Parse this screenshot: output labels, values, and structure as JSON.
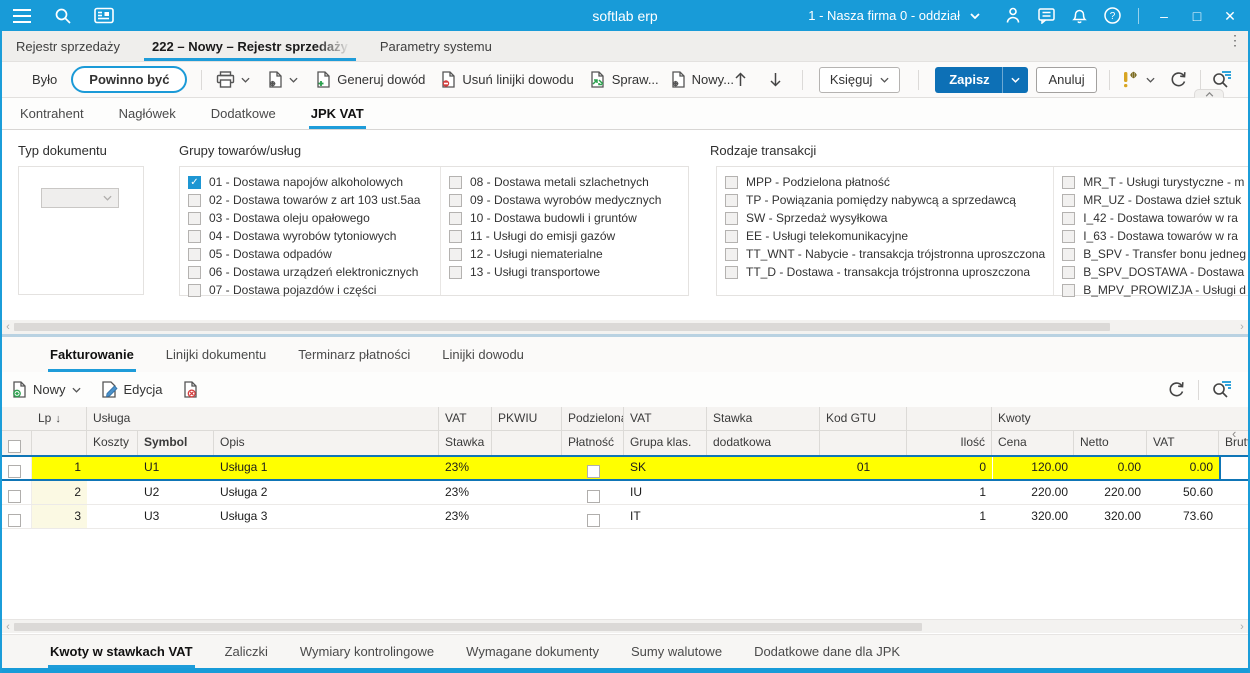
{
  "window": {
    "title": "softlab erp",
    "company": "1 - Nasza firma 0 - oddział"
  },
  "main_tabs": [
    {
      "label": "Rejestr sprzedaży",
      "active": false
    },
    {
      "label": "222 – Nowy – Rejestr sprzedaży",
      "active": true
    },
    {
      "label": "Parametry systemu",
      "active": false
    }
  ],
  "toolbar": {
    "bylo": "Było",
    "powinno_byc": "Powinno być",
    "generuj_dowod": "Generuj dowód",
    "usun_linijki": "Usuń linijki dowodu",
    "spraw": "Spraw...",
    "nowy": "Nowy...",
    "ksieguj": "Księguj",
    "zapisz": "Zapisz",
    "anuluj": "Anuluj"
  },
  "subtabs": [
    {
      "label": "Kontrahent",
      "active": false
    },
    {
      "label": "Nagłówek",
      "active": false
    },
    {
      "label": "Dodatkowe",
      "active": false
    },
    {
      "label": "JPK VAT",
      "active": true
    }
  ],
  "form": {
    "typ_dokumentu_label": "Typ dokumentu",
    "grupy_label": "Grupy towarów/usług",
    "grupy_col1": [
      {
        "label": "01 - Dostawa napojów alkoholowych",
        "checked": true
      },
      {
        "label": "02 - Dostawa towarów z art 103 ust.5aa",
        "checked": false
      },
      {
        "label": "03 - Dostawa oleju opałowego",
        "checked": false
      },
      {
        "label": "04 - Dostawa wyrobów tytoniowych",
        "checked": false
      },
      {
        "label": "05 - Dostawa odpadów",
        "checked": false
      },
      {
        "label": "06 - Dostawa urządzeń elektronicznych",
        "checked": false
      },
      {
        "label": "07 - Dostawa pojazdów i części",
        "checked": false
      }
    ],
    "grupy_col2": [
      {
        "label": "08 - Dostawa metali szlachetnych",
        "checked": false
      },
      {
        "label": "09 - Dostawa wyrobów medycznych",
        "checked": false
      },
      {
        "label": "10 - Dostawa budowli i gruntów",
        "checked": false
      },
      {
        "label": "11 - Usługi do emisji gazów",
        "checked": false
      },
      {
        "label": "12 - Usługi niematerialne",
        "checked": false
      },
      {
        "label": "13 - Usługi transportowe",
        "checked": false
      }
    ],
    "rodzaje_label": "Rodzaje transakcji",
    "rodzaje_col1": [
      {
        "label": "MPP - Podzielona płatność",
        "checked": false
      },
      {
        "label": "TP - Powiązania pomiędzy nabywcą a sprzedawcą",
        "checked": false
      },
      {
        "label": "SW - Sprzedaż wysyłkowa",
        "checked": false
      },
      {
        "label": "EE - Usługi telekomunikacyjne",
        "checked": false
      },
      {
        "label": "TT_WNT - Nabycie - transakcja trójstronna uproszczona",
        "checked": false
      },
      {
        "label": "TT_D - Dostawa - transakcja trójstronna uproszczona",
        "checked": false
      }
    ],
    "rodzaje_col2": [
      {
        "label": "MR_T - Usługi turystyczne - m",
        "checked": false
      },
      {
        "label": "MR_UZ - Dostawa dzieł sztuk",
        "checked": false
      },
      {
        "label": "I_42 - Dostawa towarów w ra",
        "checked": false
      },
      {
        "label": "I_63 - Dostawa towarów w ra",
        "checked": false
      },
      {
        "label": "B_SPV - Transfer bonu jedneg",
        "checked": false
      },
      {
        "label": "B_SPV_DOSTAWA - Dostawa",
        "checked": false
      },
      {
        "label": "B_MPV_PROWIZJA - Usługi d",
        "checked": false
      }
    ]
  },
  "section_tabs": [
    {
      "label": "Fakturowanie",
      "active": true
    },
    {
      "label": "Linijki dokumentu",
      "active": false
    },
    {
      "label": "Terminarz płatności",
      "active": false
    },
    {
      "label": "Linijki dowodu",
      "active": false
    }
  ],
  "grid_toolbar": {
    "nowy": "Nowy",
    "edycja": "Edycja"
  },
  "grid": {
    "headers": {
      "lp": "Lp",
      "usluga": "Usługa",
      "koszty": "Koszty",
      "symbol": "Symbol",
      "opis": "Opis",
      "vat": "VAT",
      "stawka": "Stawka",
      "pkwiu": "PKWIU",
      "podzielona": "Podzielona",
      "platnosc": "Płatność",
      "vat_grupa": "VAT",
      "grupa_klas": "Grupa klas.",
      "stawka_dod": "Stawka",
      "dodatkowa": "dodatkowa",
      "kod_gtu": "Kod GTU",
      "ilosc": "Ilość",
      "kwoty": "Kwoty",
      "cena": "Cena",
      "netto": "Netto",
      "vat_kwota": "VAT",
      "brutto": "Brutto"
    },
    "rows": [
      {
        "lp": "1",
        "koszty": "",
        "symbol": "U1",
        "opis": "Usługa 1",
        "stawka": "23%",
        "pkwiu": "",
        "podzielona": false,
        "grupa_klas": "SK",
        "stawka_dod": "",
        "kod_gtu": "01",
        "ilosc": "0",
        "cena": "120.00",
        "netto": "0.00",
        "vat": "0.00",
        "brutto": "",
        "selected": true
      },
      {
        "lp": "2",
        "koszty": "",
        "symbol": "U2",
        "opis": "Usługa 2",
        "stawka": "23%",
        "pkwiu": "",
        "podzielona": false,
        "grupa_klas": "IU",
        "stawka_dod": "",
        "kod_gtu": "",
        "ilosc": "1",
        "cena": "220.00",
        "netto": "220.00",
        "vat": "50.60",
        "brutto": "",
        "selected": false
      },
      {
        "lp": "3",
        "koszty": "",
        "symbol": "U3",
        "opis": "Usługa 3",
        "stawka": "23%",
        "pkwiu": "",
        "podzielona": false,
        "grupa_klas": "IT",
        "stawka_dod": "",
        "kod_gtu": "",
        "ilosc": "1",
        "cena": "320.00",
        "netto": "320.00",
        "vat": "73.60",
        "brutto": "",
        "selected": false
      }
    ]
  },
  "bottom_tabs": [
    {
      "label": "Kwoty w stawkach VAT",
      "active": true
    },
    {
      "label": "Zaliczki",
      "active": false
    },
    {
      "label": "Wymiary kontrolingowe",
      "active": false
    },
    {
      "label": "Wymagane dokumenty",
      "active": false
    },
    {
      "label": "Sumy walutowe",
      "active": false
    },
    {
      "label": "Dodatkowe dane dla JPK",
      "active": false
    }
  ],
  "icons": {
    "sort_desc": "↓",
    "move_up": "↑",
    "move_down": "↓",
    "panel_collapse": "<",
    "overflow_menu": "⋮",
    "check": "✓"
  },
  "colors": {
    "titlebar": "#189bd8",
    "accent_underline": "#1e9cd9",
    "save_button": "#0d70b6",
    "selected_row": "#ffff00",
    "selected_row_border": "#0f75b6",
    "checkbox_checked": "#1d96d3"
  }
}
